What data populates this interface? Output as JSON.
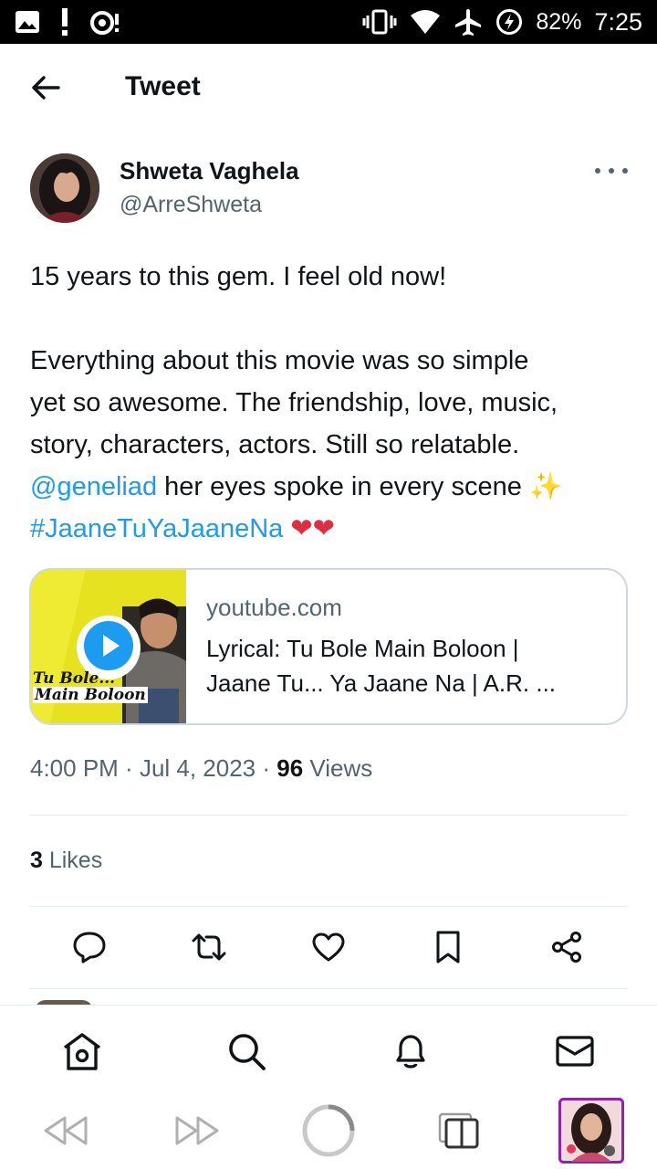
{
  "status_bar": {
    "battery": "82%",
    "time": "7:25"
  },
  "header": {
    "title": "Tweet"
  },
  "author": {
    "name": "Shweta Vaghela",
    "handle": "@ArreShweta"
  },
  "tweet": {
    "line1": "15 years to this gem. I feel old now!",
    "line2": "Everything about this movie was so simple",
    "line3": "yet so awesome. The friendship, love, music,",
    "line4": "story, characters, actors. Still so relatable.",
    "mention": "@geneliad",
    "line5_rest": " her eyes spoke in every scene ",
    "sparkle": "✨",
    "hashtag": "#JaaneTuYaJaaneNa",
    "hearts": "❤❤"
  },
  "card": {
    "domain": "youtube.com",
    "title": "Lyrical: Tu Bole Main Boloon | Jaane Tu... Ya Jaane Na | A.R. ...",
    "thumb_text_1": "Tu Bole...",
    "thumb_text_2": "Main Boloon"
  },
  "meta": {
    "time": "4:00 PM",
    "sep1": " · ",
    "date": "Jul 4, 2023",
    "sep2": " · ",
    "views_count": "96",
    "views_label": " Views"
  },
  "likes": {
    "count": "3",
    "label": " Likes"
  },
  "icons": {
    "back": "arrow-left-icon",
    "reply": "reply-icon",
    "retweet": "retweet-icon",
    "like": "heart-icon",
    "bookmark": "bookmark-icon",
    "share": "share-icon",
    "home": "home-icon",
    "search": "search-icon",
    "notifications": "bell-icon",
    "messages": "mail-icon"
  },
  "colors": {
    "accent": "#1d9bf0",
    "text": "#0f1419",
    "secondary": "#536471",
    "border": "#cfd9de"
  }
}
